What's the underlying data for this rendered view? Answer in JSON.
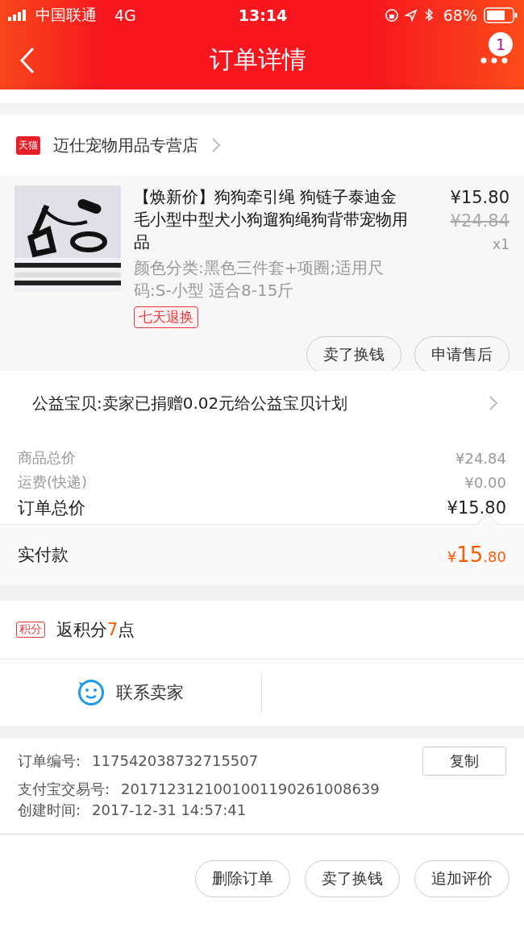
{
  "status_bar": {
    "carrier": "中国联通",
    "network": "4G",
    "time": "13:14",
    "battery": "68%"
  },
  "nav": {
    "title": "订单详情",
    "badge": "1"
  },
  "shop": {
    "tag": "天猫",
    "name": "迈仕宠物用品专营店"
  },
  "product": {
    "image": {
      "kind": "picture"
    },
    "title": "【焕新价】狗狗牵引绳 狗链子泰迪金毛小型中型犬小狗遛狗绳狗背带宠物用品",
    "sku": "颜色分类:黑色三件套+项圈;适用尺码:S-小型 适合8-15斤",
    "tag": "七天退换",
    "price": "¥15.80",
    "original_price": "¥24.84",
    "quantity": "x1",
    "buttons": [
      "卖了换钱",
      "申请售后"
    ]
  },
  "charity": "公益宝贝:卖家已捐赠0.02元给公益宝贝计划",
  "summary": [
    {
      "label": "商品总价",
      "value": "¥24.84",
      "kind": "minor"
    },
    {
      "label": "运费(快递)",
      "value": "¥0.00",
      "kind": "minor"
    },
    {
      "label": "订单总价",
      "value": "¥15.80",
      "kind": "major"
    }
  ],
  "paid": {
    "label": "实付款",
    "currency": "¥",
    "integer": "15",
    "decimal": ".80"
  },
  "points": {
    "tag": "积分",
    "text": "返积分**7**点"
  },
  "contact": "联系卖家",
  "info": [
    {
      "label": "订单编号:",
      "value": "117542038732715507",
      "copy": "复制"
    },
    {
      "label": "支付宝交易号:",
      "value": "2017123121001001190261008639"
    },
    {
      "label": "创建时间:",
      "value": "2017-12-31 14:57:41"
    }
  ],
  "actions": [
    "删除订单",
    "卖了换钱",
    "追加评价"
  ]
}
